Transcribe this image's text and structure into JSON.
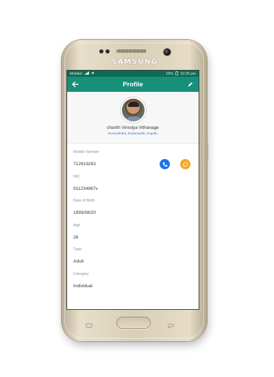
{
  "device": {
    "brand": "SAMSUNG",
    "colors": {
      "body": "#d9cfb8",
      "app_bar": "#17907a",
      "status_bar": "#0d6b56"
    }
  },
  "status_bar": {
    "carrier": "Mobitel",
    "battery": "15%",
    "time": "10:25 pm"
  },
  "app_bar": {
    "title": "Profile",
    "back_icon": "arrow-left-icon",
    "edit_icon": "pencil-icon"
  },
  "profile": {
    "name": "charith Vinodya Vithanage",
    "address": "Moranathitha, Ruwanwella, Kegalle,"
  },
  "fields": [
    {
      "label": "Mobile Number",
      "value": "712919292"
    },
    {
      "label": "NIC",
      "value": "911234987v"
    },
    {
      "label": "Date of Birth",
      "value": "1993/08/20"
    },
    {
      "label": "Age",
      "value": "26"
    },
    {
      "label": "Type",
      "value": "Adult"
    },
    {
      "label": "Category",
      "value": "Individual"
    }
  ],
  "actions": {
    "call_icon": "phone-icon",
    "message_icon": "chat-bubble-icon",
    "call_color": "#1e74e6",
    "message_color": "#f6a623"
  }
}
